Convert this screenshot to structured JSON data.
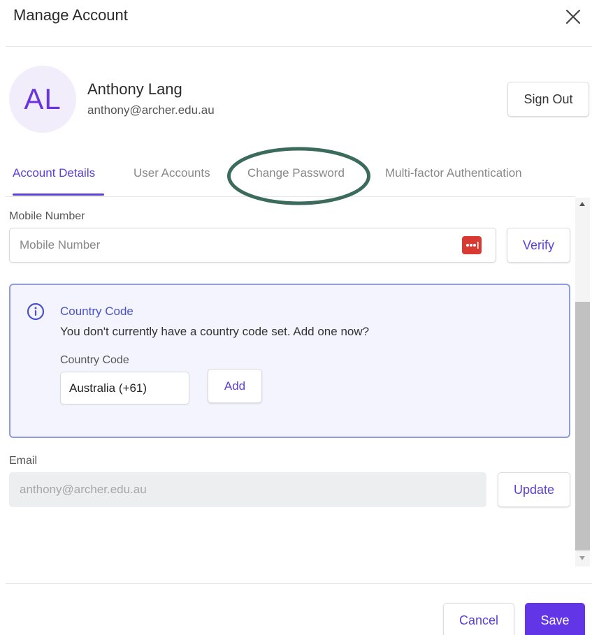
{
  "dialog": {
    "title": "Manage Account"
  },
  "profile": {
    "initials": "AL",
    "name": "Anthony Lang",
    "email": "anthony@archer.edu.au",
    "sign_out_label": "Sign Out"
  },
  "tabs": [
    {
      "label": "Account Details",
      "active": true
    },
    {
      "label": "User Accounts",
      "active": false
    },
    {
      "label": "Change Password",
      "active": false
    },
    {
      "label": "Multi-factor Authentication",
      "active": false
    }
  ],
  "mobile": {
    "label": "Mobile Number",
    "placeholder": "Mobile Number",
    "value": "",
    "verify_label": "Verify"
  },
  "country_alert": {
    "title": "Country Code",
    "message": "You don't currently have a country code set. Add one now?",
    "field_label": "Country Code",
    "selected_value": "Australia (+61)",
    "add_label": "Add"
  },
  "email_field": {
    "label": "Email",
    "value": "anthony@archer.edu.au",
    "update_label": "Update"
  },
  "footer": {
    "cancel_label": "Cancel",
    "save_label": "Save"
  },
  "icons": {
    "close": "close-icon",
    "info": "info-icon",
    "password_manager": "password-manager-icon"
  },
  "colors": {
    "accent": "#5b3fd6",
    "save_background": "#6236e6",
    "alert_border": "#8e9bdf",
    "alert_background": "#f3f4fe",
    "avatar_background": "#f2edfb",
    "annotation": "#3a6b5c",
    "password_icon": "#d83a33"
  }
}
